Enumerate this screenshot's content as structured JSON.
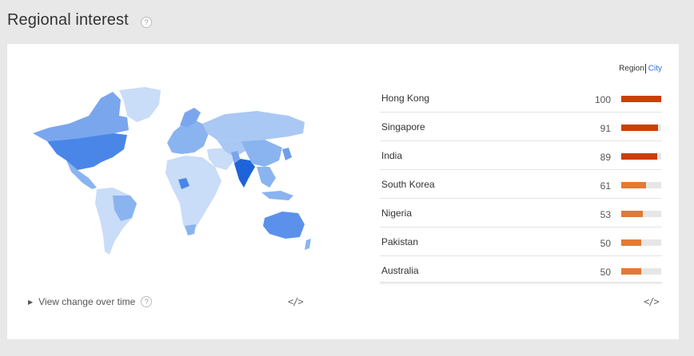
{
  "header": {
    "title": "Regional interest",
    "help": "?"
  },
  "toggle": {
    "region": "Region",
    "city": "City"
  },
  "footer": {
    "view_change": "View change over time",
    "help": "?",
    "embed": "</>"
  },
  "colors": {
    "high": "#cc3e04",
    "mid": "#e27a34",
    "map_dark": "#4a86e8",
    "map_mid": "#8ab4f0",
    "map_light": "#c9dcf8"
  },
  "regions": [
    {
      "name": "Hong Kong",
      "value": 100
    },
    {
      "name": "Singapore",
      "value": 91
    },
    {
      "name": "India",
      "value": 89
    },
    {
      "name": "South Korea",
      "value": 61
    },
    {
      "name": "Nigeria",
      "value": 53
    },
    {
      "name": "Pakistan",
      "value": 50
    },
    {
      "name": "Australia",
      "value": 50
    }
  ]
}
